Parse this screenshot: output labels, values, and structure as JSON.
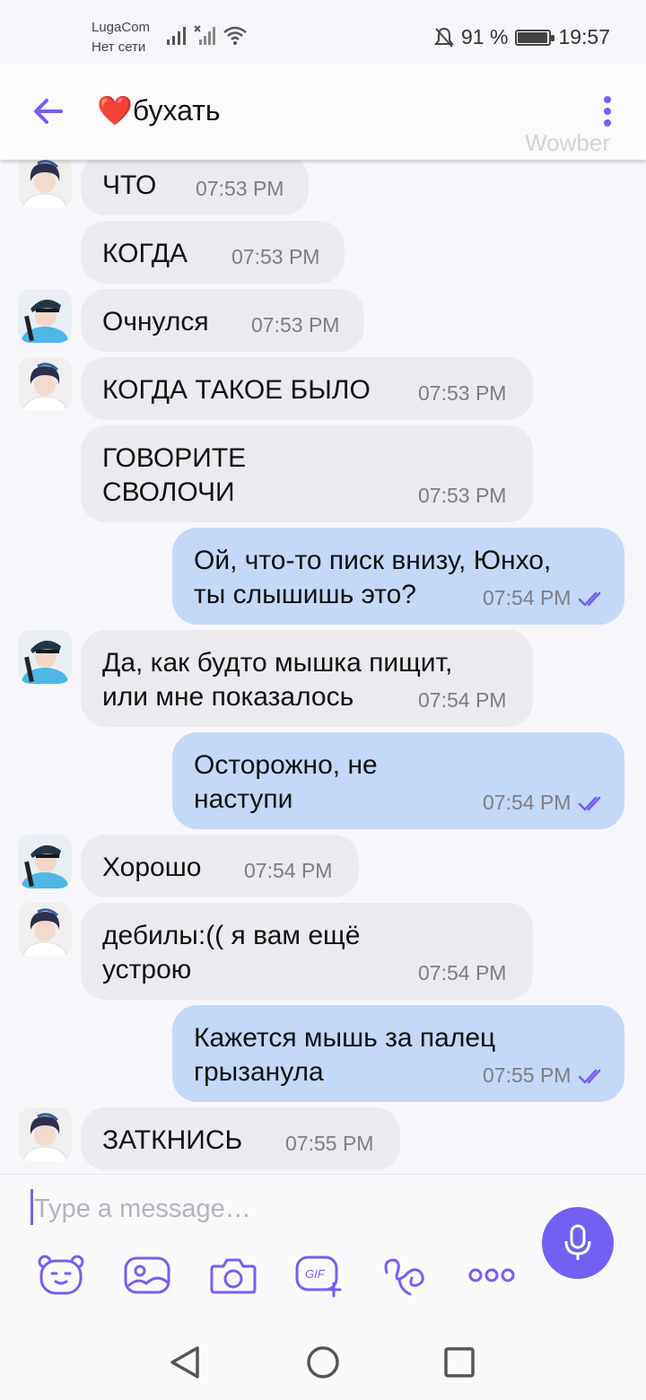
{
  "status_bar": {
    "carrier": "LugaCom",
    "network": "Нет сети",
    "battery": "91 %",
    "time": "19:57"
  },
  "header": {
    "title": "❤️бухать",
    "watermark": "Wowber"
  },
  "messages": [
    {
      "dir": "in",
      "text": "ЧТО",
      "time": "07:53 PM",
      "avatar": true,
      "avatar_style": "dark"
    },
    {
      "dir": "in",
      "text": "КОГДА",
      "time": "07:53 PM",
      "avatar": false
    },
    {
      "dir": "in",
      "text": "Очнулся",
      "time": "07:53 PM",
      "avatar": true,
      "avatar_style": "cap"
    },
    {
      "dir": "in",
      "text": "КОГДА ТАКОЕ БЫЛО",
      "time": "07:53 PM",
      "avatar": true,
      "avatar_style": "dark"
    },
    {
      "dir": "in",
      "text": "ГОВОРИТЕ\nСВОЛОЧИ",
      "time": "07:53 PM",
      "avatar": false
    },
    {
      "dir": "out",
      "text": "Ой, что-то писк внизу, Юнхо,\nты слышишь это?",
      "time": "07:54 PM"
    },
    {
      "dir": "in",
      "text": "Да, как будто мышка пищит,\nили мне показалось",
      "time": "07:54 PM",
      "avatar": true,
      "avatar_style": "cap"
    },
    {
      "dir": "out",
      "text": "Осторожно, не\nнаступи",
      "time": "07:54 PM"
    },
    {
      "dir": "in",
      "text": "Хорошо",
      "time": "07:54 PM",
      "avatar": true,
      "avatar_style": "cap"
    },
    {
      "dir": "in",
      "text": "дебилы:(( я вам ещё\nустрою",
      "time": "07:54 PM",
      "avatar": true,
      "avatar_style": "dark"
    },
    {
      "dir": "out",
      "text": "Кажется мышь за палец\nгрызанула",
      "time": "07:55 PM"
    },
    {
      "dir": "in",
      "text": "ЗАТКНИСЬ",
      "time": "07:55 PM",
      "avatar": true,
      "avatar_style": "dark"
    }
  ],
  "composer": {
    "placeholder": "Type a message…",
    "tools": [
      "sticker-icon",
      "gallery-icon",
      "camera-icon",
      "gif-icon",
      "doodle-icon",
      "more-icon"
    ]
  },
  "colors": {
    "accent": "#7360f2",
    "incoming_bubble": "#ebeaef",
    "outgoing_bubble": "#c4d8f7"
  }
}
